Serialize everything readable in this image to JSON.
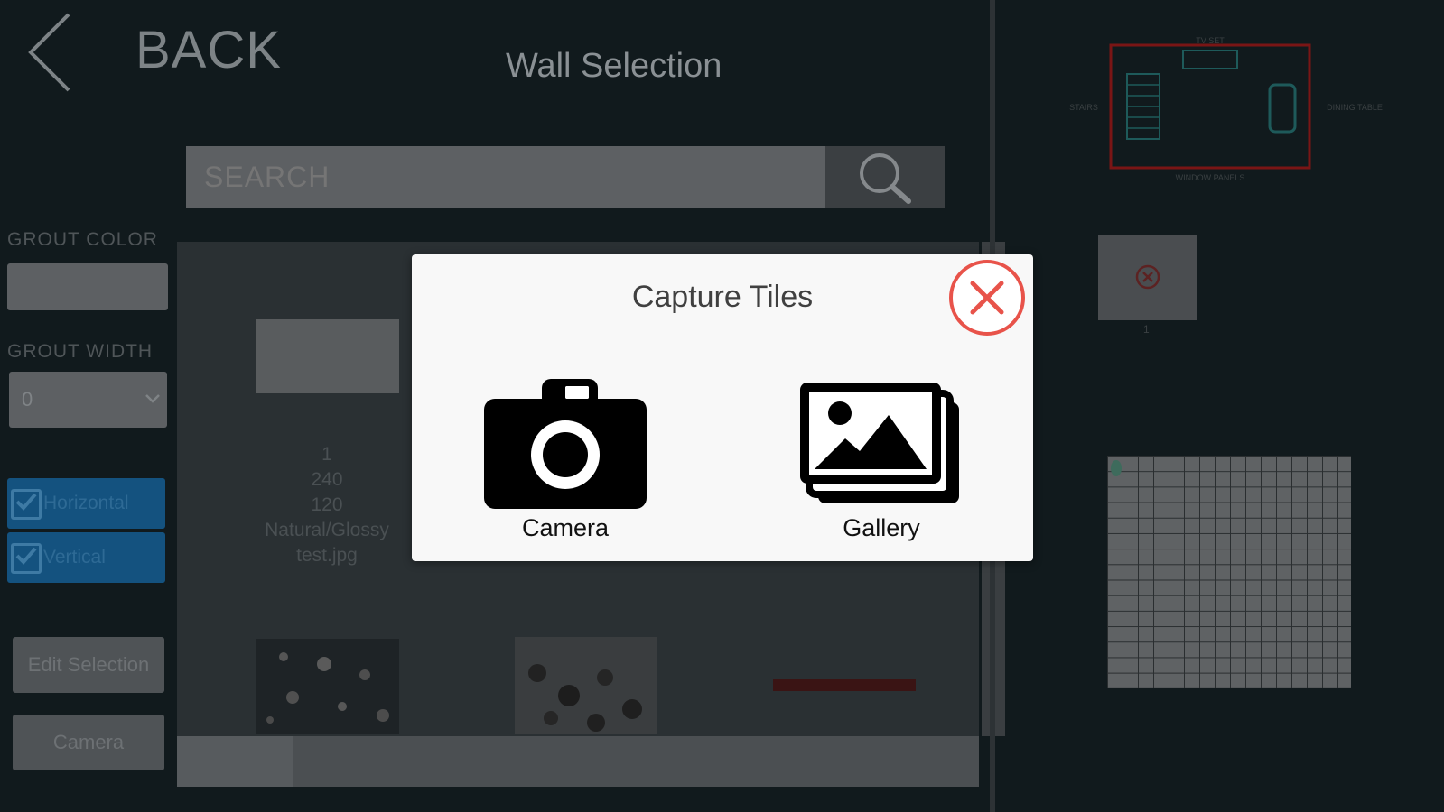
{
  "header": {
    "back_label": "BACK",
    "title": "Wall Selection"
  },
  "search": {
    "placeholder": "SEARCH"
  },
  "sidebar": {
    "grout_color_label": "GROUT COLOR",
    "grout_width_label": "GROUT WIDTH",
    "grout_width_value": "0",
    "horizontal_label": "Horizontal",
    "vertical_label": "Vertical",
    "edit_selection_label": "Edit Selection",
    "camera_label": "Camera"
  },
  "tiles": [
    {
      "lines": [
        "1",
        "240",
        "120",
        "Natural/Glossy",
        "test.jpg"
      ]
    }
  ],
  "floor_plan": {
    "top_label": "TV SET",
    "left_label": "STAIRS",
    "right_label": "DINING TABLE",
    "bottom_label": "WINDOW PANELS"
  },
  "preview": {
    "caption": "1"
  },
  "modal": {
    "title": "Capture Tiles",
    "options": [
      {
        "label": "Camera",
        "icon": "camera-icon"
      },
      {
        "label": "Gallery",
        "icon": "gallery-icon"
      }
    ]
  },
  "colors": {
    "accent_close": "#e8534a",
    "checkbox_blue": "#14527f"
  }
}
